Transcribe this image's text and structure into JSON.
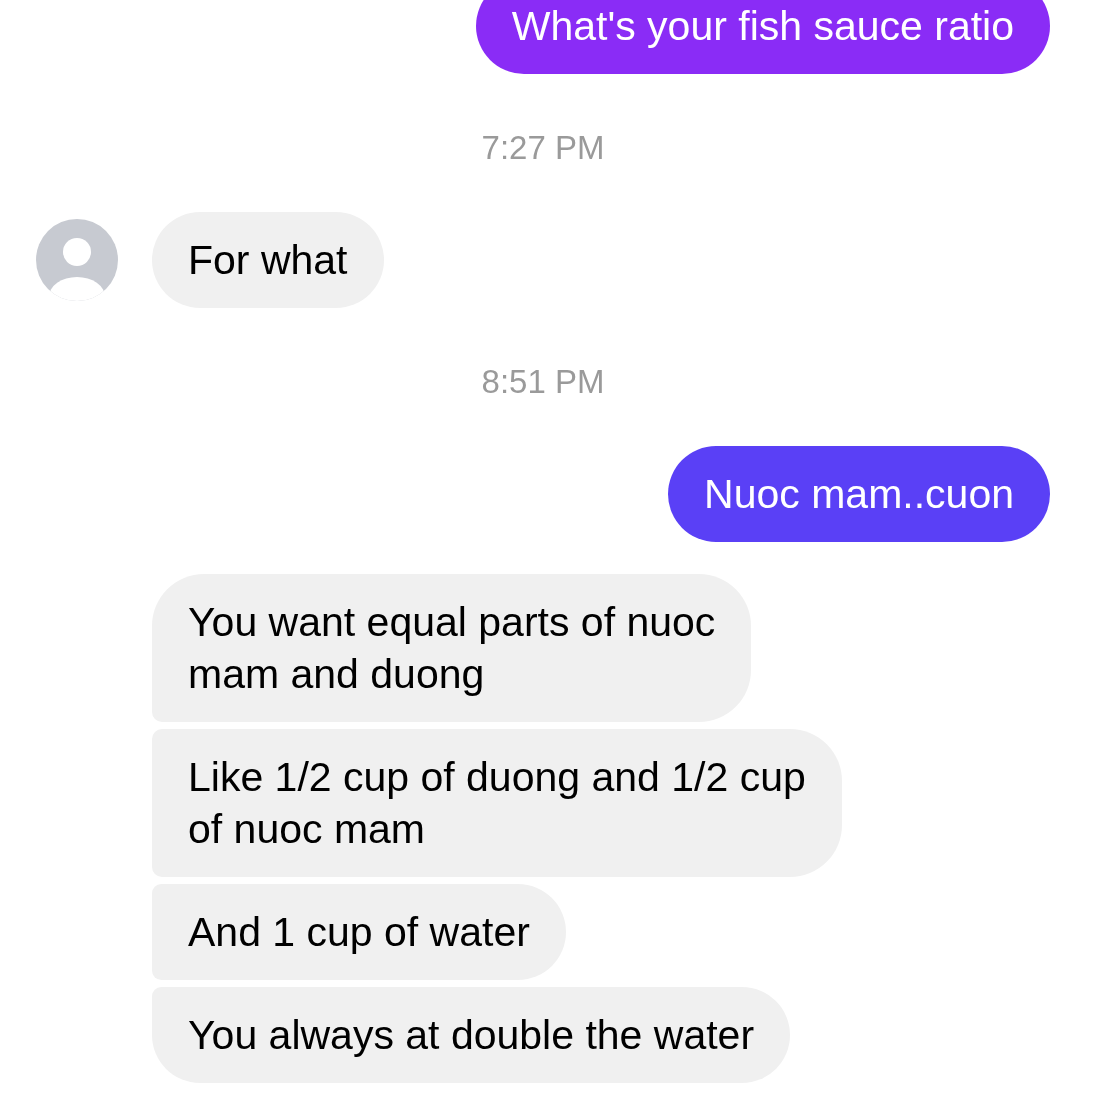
{
  "messages": [
    {
      "kind": "sent",
      "text": "What's your fish sauce ratio",
      "color": "#8a2cf6"
    },
    {
      "kind": "timestamp",
      "text": "7:27 PM"
    },
    {
      "kind": "received",
      "lines": [
        "For what"
      ],
      "show_avatar": true
    },
    {
      "kind": "timestamp",
      "text": "8:51 PM"
    },
    {
      "kind": "sent",
      "text": "Nuoc mam..cuon",
      "color": "#5a40f6"
    },
    {
      "kind": "received",
      "lines": [
        "You want equal parts of nuoc",
        "mam and duong"
      ],
      "show_avatar": false
    },
    {
      "kind": "received",
      "lines": [
        "Like 1/2 cup of duong and 1/2 cup",
        "of nuoc mam"
      ],
      "show_avatar": false
    },
    {
      "kind": "received",
      "lines": [
        "And 1 cup of water"
      ],
      "show_avatar": false
    },
    {
      "kind": "received",
      "lines": [
        "You always at double the water"
      ],
      "show_avatar": false
    }
  ]
}
